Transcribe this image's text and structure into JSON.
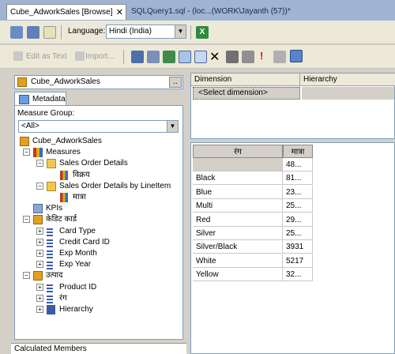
{
  "tabs": {
    "active": "Cube_AdworkSales [Browse]",
    "other": "SQLQuery1.sql - (loc...(WORK\\Jayanth (57))*"
  },
  "toolbar1": {
    "language_label": "Language:",
    "language_value": "Hindi (India)"
  },
  "toolbar2": {
    "edit_as_text": "Edit as Text",
    "import": "Import..."
  },
  "cube": {
    "name": "Cube_AdworkSales",
    "ellipsis": ".."
  },
  "metadata_tab": "Metadata",
  "measure_group": {
    "label": "Measure Group:",
    "value": "<All>"
  },
  "tree": [
    {
      "label": "Cube_AdworkSales",
      "indent": 0,
      "icon": "cube-icon",
      "expander": ""
    },
    {
      "label": "Measures",
      "indent": 1,
      "icon": "measures-icon",
      "expander": "-"
    },
    {
      "label": "Sales Order Details",
      "indent": 2,
      "icon": "folder-icon",
      "expander": "-"
    },
    {
      "label": "विक्रय",
      "indent": 3,
      "icon": "measure-icon",
      "expander": ""
    },
    {
      "label": "Sales Order Details by LineItem",
      "indent": 2,
      "icon": "folder-icon",
      "expander": "-"
    },
    {
      "label": "मात्रा",
      "indent": 3,
      "icon": "measure-icon",
      "expander": ""
    },
    {
      "label": "KPIs",
      "indent": 1,
      "icon": "kpi-icon",
      "expander": ""
    },
    {
      "label": "केडिट कार्ड",
      "indent": 1,
      "icon": "dimension-icon",
      "expander": "-"
    },
    {
      "label": "Card Type",
      "indent": 2,
      "icon": "attribute-icon",
      "expander": "+"
    },
    {
      "label": "Credit Card ID",
      "indent": 2,
      "icon": "attribute-icon",
      "expander": "+"
    },
    {
      "label": "Exp Month",
      "indent": 2,
      "icon": "attribute-icon",
      "expander": "+"
    },
    {
      "label": "Exp Year",
      "indent": 2,
      "icon": "attribute-icon",
      "expander": "+"
    },
    {
      "label": "उत्पाद",
      "indent": 1,
      "icon": "dimension-icon",
      "expander": "-"
    },
    {
      "label": "Product ID",
      "indent": 2,
      "icon": "attribute-icon",
      "expander": "+"
    },
    {
      "label": "रंग",
      "indent": 2,
      "icon": "attribute-icon",
      "expander": "+"
    },
    {
      "label": "Hierarchy",
      "indent": 2,
      "icon": "hierarchy-icon",
      "expander": "+"
    }
  ],
  "calculated_members": "Calculated Members",
  "filter": {
    "col_dimension": "Dimension",
    "col_hierarchy": "Hierarchy",
    "select_dimension": "<Select dimension>"
  },
  "grid": {
    "headers": [
      "रंग",
      "मात्रा"
    ],
    "rows": [
      [
        "",
        "48..."
      ],
      [
        "Black",
        "81..."
      ],
      [
        "Blue",
        "23..."
      ],
      [
        "Multi",
        "25..."
      ],
      [
        "Red",
        "29..."
      ],
      [
        "Silver",
        "25..."
      ],
      [
        "Silver/Black",
        "3931"
      ],
      [
        "White",
        "5217"
      ],
      [
        "Yellow",
        "32..."
      ]
    ]
  }
}
